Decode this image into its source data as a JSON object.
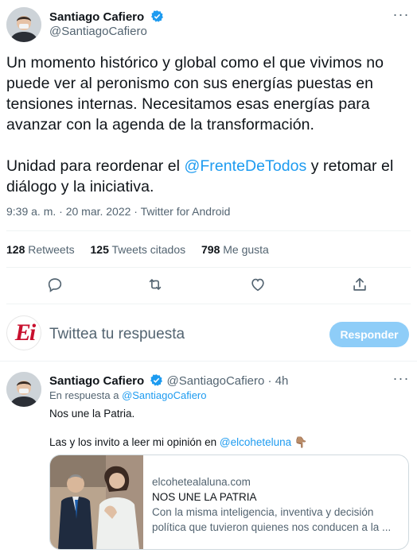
{
  "tweet": {
    "author_name": "Santiago Cafiero",
    "author_handle": "@SantiagoCafiero",
    "paragraph1": "Un momento histórico y global como el que vivimos no puede ver al peronismo con sus energías puestas en tensiones internas. Necesitamos esas energías para avanzar con la agenda de la transformación.",
    "paragraph2_before": "Unidad para reordenar el ",
    "paragraph2_mention": "@FrenteDeTodos",
    "paragraph2_after": " y retomar el diálogo y la iniciativa.",
    "meta": "9:39 a. m. · 20 mar. 2022 · Twitter for Android",
    "stats": {
      "retweets_count": "128",
      "retweets_label": "Retweets",
      "quotes_count": "125",
      "quotes_label": "Tweets citados",
      "likes_count": "798",
      "likes_label": "Me gusta"
    },
    "actions": [
      "reply-icon",
      "retweet-icon",
      "like-icon",
      "share-icon"
    ]
  },
  "composer": {
    "avatar_text": "Ei",
    "placeholder": "Twittea tu respuesta",
    "button_label": "Responder"
  },
  "reply": {
    "author_name": "Santiago Cafiero",
    "author_handle": "@SantiagoCafiero",
    "separator": "·",
    "time": "4h",
    "in_reply_prefix": "En respuesta a ",
    "in_reply_handle": "@SantiagoCafiero",
    "line1": "Nos une la Patria.",
    "line2_before": "Las y los invito a leer mi opinión en ",
    "line2_mention": "@elcoheteluna",
    "line2_emoji": "👇🏽",
    "card": {
      "domain": "elcohetealaluna.com",
      "title": "NOS UNE LA PATRIA",
      "description": "Con la misma inteligencia, inventiva y decisión política que tuvieron quienes nos conducen a la ..."
    }
  },
  "colors": {
    "accent": "#1d9bf0",
    "muted": "#536471",
    "button_disabled": "#8ecdf8",
    "brand_red": "#c8102e"
  }
}
